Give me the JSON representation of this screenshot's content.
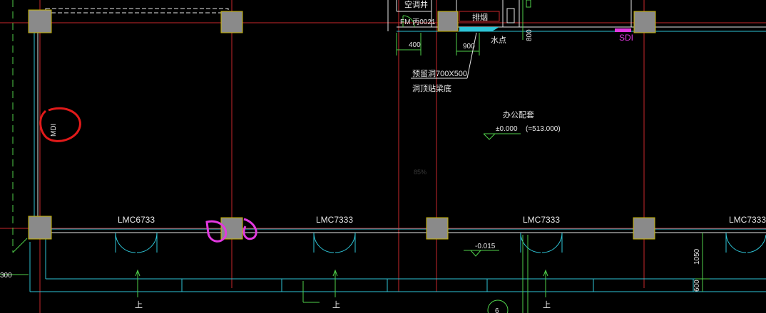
{
  "labels": {
    "ac_shaft": "空调井",
    "fm_door": "FM 丙0021",
    "exhaust": "排烟",
    "dim_400": "400",
    "dim_900": "900",
    "water_point": "水点",
    "dim_800": "800",
    "sdi": "SDI",
    "reserved_hole": "预留洞700X500",
    "hole_note": "洞顶贴梁底",
    "room_name": "办公配套",
    "elevation": "±0.000",
    "elevation_abs": "(=513.000)",
    "watermark": "85%",
    "mdi": "MDI",
    "door_1": "LMC6733",
    "door_2": "LMC7333",
    "door_3": "LMC7333",
    "door_4": "LMC7333",
    "level_outdoor": "-0.015",
    "dim_1050": "1050",
    "dim_600": "600",
    "dim_300": "300",
    "stair_up_1": "上",
    "stair_up_2": "上",
    "stair_up_3": "上",
    "grid_6": "6"
  },
  "colors": {
    "background": "#000000",
    "grid_line": "#c8282d",
    "wall_cyan": "#2ec4d6",
    "column_fill": "#8a8a8a",
    "column_outline": "#c8b400",
    "text": "#e6e6e6",
    "dim_line": "#4fd14a",
    "markup": "#e21a1a",
    "markup_magenta": "#e238e0"
  }
}
